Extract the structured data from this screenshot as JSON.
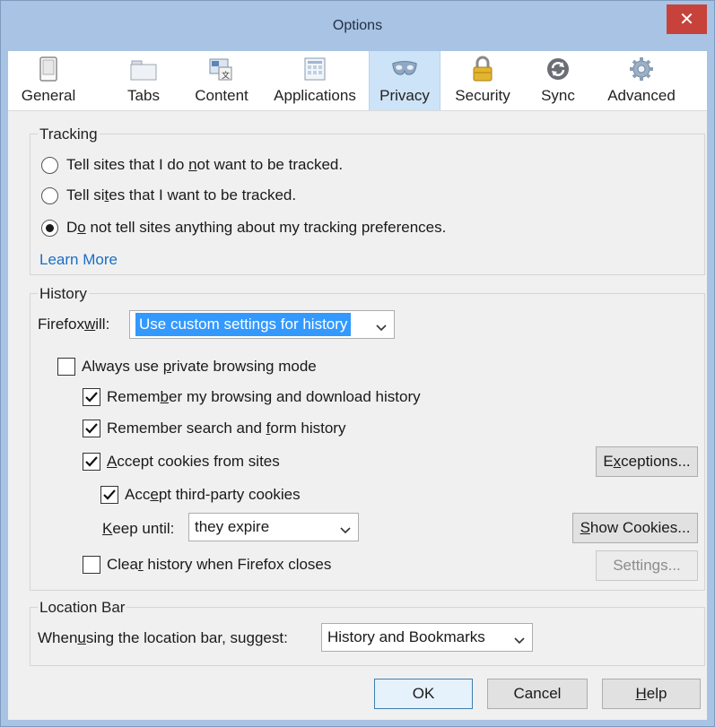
{
  "window": {
    "title": "Options"
  },
  "toolbar": {
    "items": [
      {
        "label": "General",
        "icon": "general-icon"
      },
      {
        "label": "Tabs",
        "icon": "tabs-icon"
      },
      {
        "label": "Content",
        "icon": "content-icon"
      },
      {
        "label": "Applications",
        "icon": "applications-icon"
      },
      {
        "label": "Privacy",
        "icon": "privacy-mask-icon",
        "active": true
      },
      {
        "label": "Security",
        "icon": "padlock-icon"
      },
      {
        "label": "Sync",
        "icon": "sync-icon"
      },
      {
        "label": "Advanced",
        "icon": "gear-icon"
      }
    ]
  },
  "tracking": {
    "legend": "Tracking",
    "options": [
      {
        "pre": "Tell sites that I do ",
        "ul": "n",
        "post": "ot want to be tracked.",
        "selected": false
      },
      {
        "pre": "Tell si",
        "ul": "t",
        "post": "es that I want to be tracked.",
        "selected": false
      },
      {
        "pre": "D",
        "ul": "o",
        "post": " not tell sites anything about my tracking preferences.",
        "selected": true
      }
    ],
    "learn_more": "Learn More"
  },
  "history": {
    "legend": "History",
    "firefox_will_pre": "Firefox ",
    "firefox_will_ul": "w",
    "firefox_will_post": "ill:",
    "mode_value": "Use custom settings for history",
    "private_pre": "Always use ",
    "private_ul": "p",
    "private_post": "rivate browsing mode",
    "remember_browsing_pre": "Remem",
    "remember_browsing_ul": "b",
    "remember_browsing_post": "er my browsing and download history",
    "remember_search_pre": "Remember search and ",
    "remember_search_ul": "f",
    "remember_search_post": "orm history",
    "accept_cookies_pre": "",
    "accept_cookies_ul": "A",
    "accept_cookies_post": "ccept cookies from sites",
    "third_party_pre": "Acc",
    "third_party_ul": "e",
    "third_party_post": "pt third-party cookies",
    "keep_until_pre": "",
    "keep_until_ul": "K",
    "keep_until_post": "eep until:",
    "keep_until_value": "they expire",
    "clear_pre": "Clea",
    "clear_ul": "r",
    "clear_post": " history when Firefox closes",
    "exceptions_pre": "E",
    "exceptions_ul": "x",
    "exceptions_post": "ceptions...",
    "show_cookies_pre": "",
    "show_cookies_ul": "S",
    "show_cookies_post": "how Cookies...",
    "settings_label": "Settings...",
    "checks": {
      "private": false,
      "remember_browsing": true,
      "remember_search": true,
      "accept_cookies": true,
      "third_party": true,
      "clear": false
    }
  },
  "location_bar": {
    "legend": "Location Bar",
    "suggest_pre": "When ",
    "suggest_ul": "u",
    "suggest_post": "sing the location bar, suggest:",
    "suggest_value": "History and Bookmarks"
  },
  "footer": {
    "ok": "OK",
    "cancel": "Cancel",
    "help_ul": "H",
    "help_post": "elp"
  },
  "colors": {
    "accent": "#3399ff",
    "link": "#1a6fc4",
    "close": "#c7423a",
    "titlebar": "#a9c3e4"
  }
}
